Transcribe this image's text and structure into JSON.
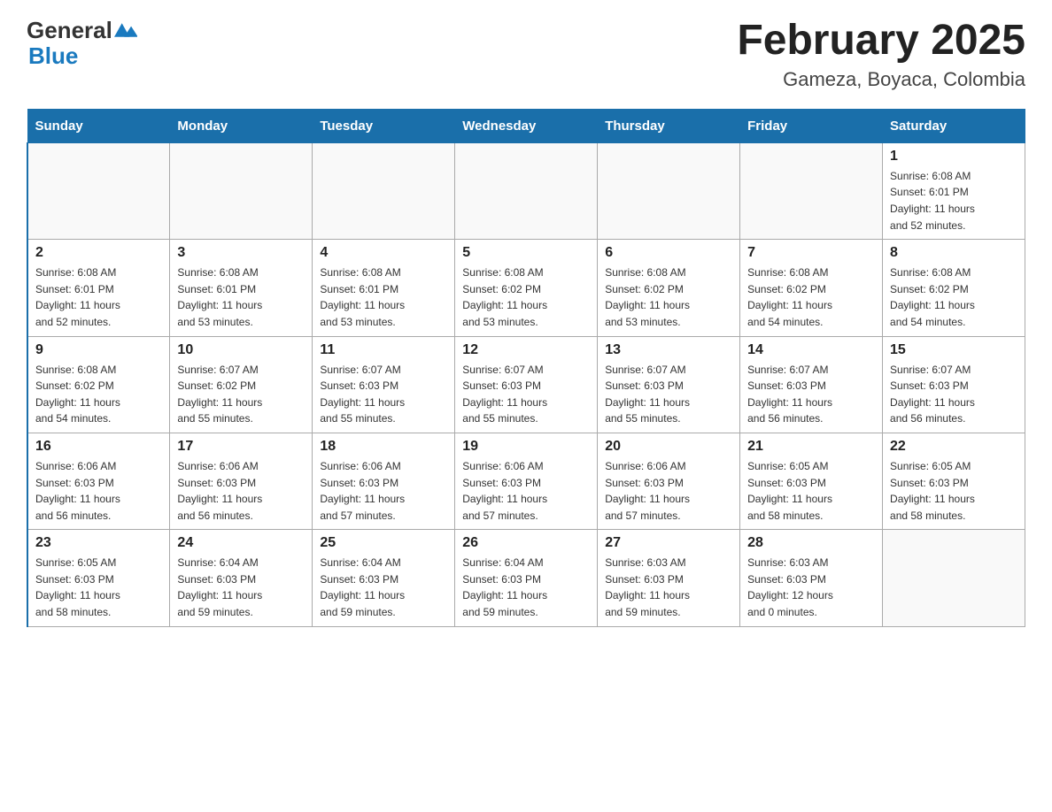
{
  "logo": {
    "general": "General",
    "blue": "Blue"
  },
  "header": {
    "month": "February 2025",
    "location": "Gameza, Boyaca, Colombia"
  },
  "weekdays": [
    "Sunday",
    "Monday",
    "Tuesday",
    "Wednesday",
    "Thursday",
    "Friday",
    "Saturday"
  ],
  "weeks": [
    [
      {
        "day": "",
        "info": ""
      },
      {
        "day": "",
        "info": ""
      },
      {
        "day": "",
        "info": ""
      },
      {
        "day": "",
        "info": ""
      },
      {
        "day": "",
        "info": ""
      },
      {
        "day": "",
        "info": ""
      },
      {
        "day": "1",
        "info": "Sunrise: 6:08 AM\nSunset: 6:01 PM\nDaylight: 11 hours\nand 52 minutes."
      }
    ],
    [
      {
        "day": "2",
        "info": "Sunrise: 6:08 AM\nSunset: 6:01 PM\nDaylight: 11 hours\nand 52 minutes."
      },
      {
        "day": "3",
        "info": "Sunrise: 6:08 AM\nSunset: 6:01 PM\nDaylight: 11 hours\nand 53 minutes."
      },
      {
        "day": "4",
        "info": "Sunrise: 6:08 AM\nSunset: 6:01 PM\nDaylight: 11 hours\nand 53 minutes."
      },
      {
        "day": "5",
        "info": "Sunrise: 6:08 AM\nSunset: 6:02 PM\nDaylight: 11 hours\nand 53 minutes."
      },
      {
        "day": "6",
        "info": "Sunrise: 6:08 AM\nSunset: 6:02 PM\nDaylight: 11 hours\nand 53 minutes."
      },
      {
        "day": "7",
        "info": "Sunrise: 6:08 AM\nSunset: 6:02 PM\nDaylight: 11 hours\nand 54 minutes."
      },
      {
        "day": "8",
        "info": "Sunrise: 6:08 AM\nSunset: 6:02 PM\nDaylight: 11 hours\nand 54 minutes."
      }
    ],
    [
      {
        "day": "9",
        "info": "Sunrise: 6:08 AM\nSunset: 6:02 PM\nDaylight: 11 hours\nand 54 minutes."
      },
      {
        "day": "10",
        "info": "Sunrise: 6:07 AM\nSunset: 6:02 PM\nDaylight: 11 hours\nand 55 minutes."
      },
      {
        "day": "11",
        "info": "Sunrise: 6:07 AM\nSunset: 6:03 PM\nDaylight: 11 hours\nand 55 minutes."
      },
      {
        "day": "12",
        "info": "Sunrise: 6:07 AM\nSunset: 6:03 PM\nDaylight: 11 hours\nand 55 minutes."
      },
      {
        "day": "13",
        "info": "Sunrise: 6:07 AM\nSunset: 6:03 PM\nDaylight: 11 hours\nand 55 minutes."
      },
      {
        "day": "14",
        "info": "Sunrise: 6:07 AM\nSunset: 6:03 PM\nDaylight: 11 hours\nand 56 minutes."
      },
      {
        "day": "15",
        "info": "Sunrise: 6:07 AM\nSunset: 6:03 PM\nDaylight: 11 hours\nand 56 minutes."
      }
    ],
    [
      {
        "day": "16",
        "info": "Sunrise: 6:06 AM\nSunset: 6:03 PM\nDaylight: 11 hours\nand 56 minutes."
      },
      {
        "day": "17",
        "info": "Sunrise: 6:06 AM\nSunset: 6:03 PM\nDaylight: 11 hours\nand 56 minutes."
      },
      {
        "day": "18",
        "info": "Sunrise: 6:06 AM\nSunset: 6:03 PM\nDaylight: 11 hours\nand 57 minutes."
      },
      {
        "day": "19",
        "info": "Sunrise: 6:06 AM\nSunset: 6:03 PM\nDaylight: 11 hours\nand 57 minutes."
      },
      {
        "day": "20",
        "info": "Sunrise: 6:06 AM\nSunset: 6:03 PM\nDaylight: 11 hours\nand 57 minutes."
      },
      {
        "day": "21",
        "info": "Sunrise: 6:05 AM\nSunset: 6:03 PM\nDaylight: 11 hours\nand 58 minutes."
      },
      {
        "day": "22",
        "info": "Sunrise: 6:05 AM\nSunset: 6:03 PM\nDaylight: 11 hours\nand 58 minutes."
      }
    ],
    [
      {
        "day": "23",
        "info": "Sunrise: 6:05 AM\nSunset: 6:03 PM\nDaylight: 11 hours\nand 58 minutes."
      },
      {
        "day": "24",
        "info": "Sunrise: 6:04 AM\nSunset: 6:03 PM\nDaylight: 11 hours\nand 59 minutes."
      },
      {
        "day": "25",
        "info": "Sunrise: 6:04 AM\nSunset: 6:03 PM\nDaylight: 11 hours\nand 59 minutes."
      },
      {
        "day": "26",
        "info": "Sunrise: 6:04 AM\nSunset: 6:03 PM\nDaylight: 11 hours\nand 59 minutes."
      },
      {
        "day": "27",
        "info": "Sunrise: 6:03 AM\nSunset: 6:03 PM\nDaylight: 11 hours\nand 59 minutes."
      },
      {
        "day": "28",
        "info": "Sunrise: 6:03 AM\nSunset: 6:03 PM\nDaylight: 12 hours\nand 0 minutes."
      },
      {
        "day": "",
        "info": ""
      }
    ]
  ]
}
